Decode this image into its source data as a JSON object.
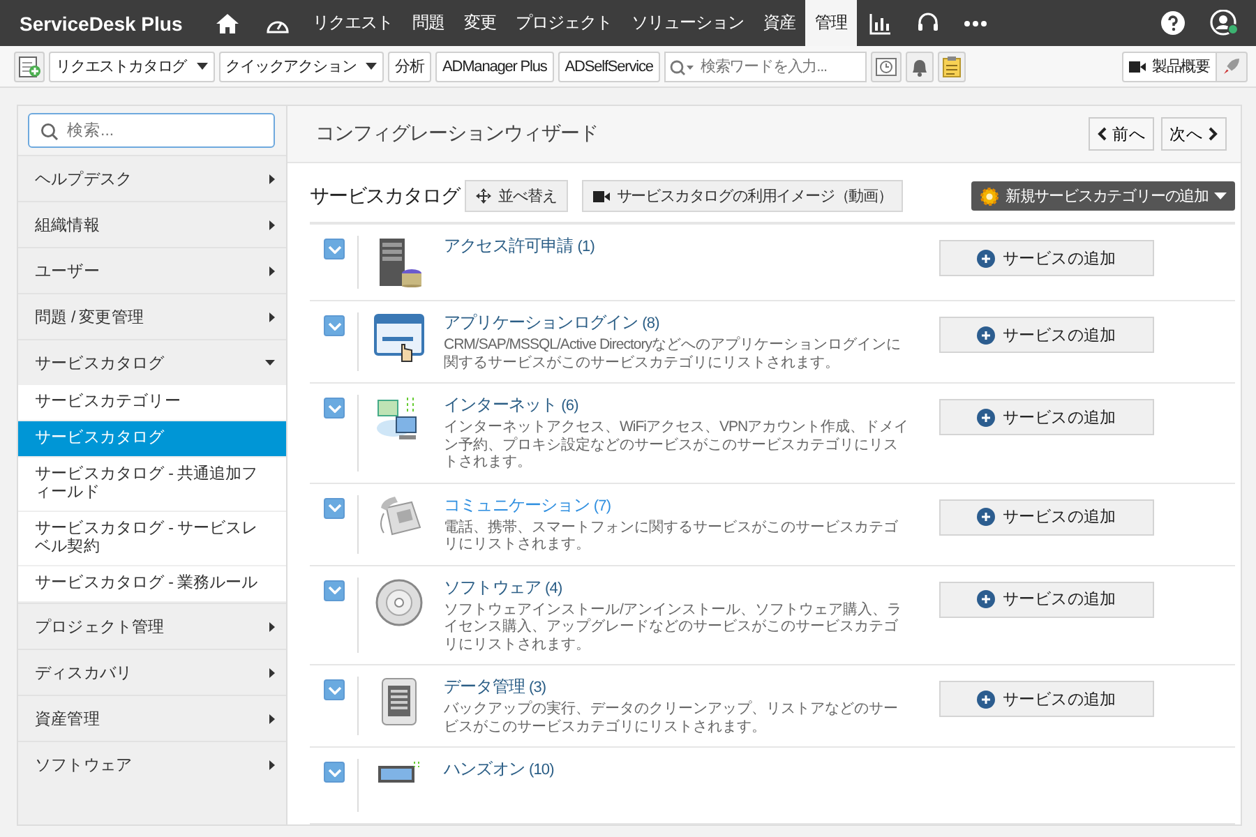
{
  "nav": {
    "logo": "ServiceDesk Plus",
    "tabs": [
      {
        "label": "リクエスト",
        "selected": false
      },
      {
        "label": "問題",
        "selected": false
      },
      {
        "label": "変更",
        "selected": false
      },
      {
        "label": "プロジェクト",
        "selected": false
      },
      {
        "label": "ソリューション",
        "selected": false
      },
      {
        "label": "資産",
        "selected": false
      },
      {
        "label": "管理",
        "selected": true
      }
    ]
  },
  "toolbar": {
    "dropdowns": [
      "リクエストカタログ",
      "クイックアクション"
    ],
    "buttons": [
      "分析",
      "ADManager Plus",
      "ADSelfService"
    ],
    "search": {
      "placeholder": "検索ワードを入力..."
    },
    "product_button": "製品概要"
  },
  "sidebar": {
    "search": {
      "placeholder": "検索..."
    },
    "items": [
      {
        "label": "ヘルプデスク",
        "expanded": false
      },
      {
        "label": "組織情報",
        "expanded": false
      },
      {
        "label": "ユーザー",
        "expanded": false
      },
      {
        "label": "問題 / 変更管理",
        "expanded": false
      },
      {
        "label": "サービスカタログ",
        "expanded": true,
        "children": [
          {
            "label": "サービスカテゴリー",
            "selected": false
          },
          {
            "label": "サービスカタログ",
            "selected": true
          },
          {
            "label": "サービスカタログ - 共通追加フィールド",
            "selected": false
          },
          {
            "label": "サービスカタログ - サービスレベル契約",
            "selected": false
          },
          {
            "label": "サービスカタログ - 業務ルール",
            "selected": false
          }
        ]
      },
      {
        "label": "プロジェクト管理",
        "expanded": false
      },
      {
        "label": "ディスカバリ",
        "expanded": false
      },
      {
        "label": "資産管理",
        "expanded": false
      },
      {
        "label": "ソフトウェア",
        "expanded": false
      }
    ]
  },
  "main": {
    "title": "コンフィグレーションウィザード",
    "prev": "前へ",
    "next": "次へ",
    "heading": "サービスカタログ",
    "sort_button": "並べ替え",
    "video_button": "サービスカタログの利用イメージ（動画）",
    "add_category_button": "新規サービスカテゴリーの追加",
    "categories": [
      {
        "title": "アクセス許可申請",
        "count": "(1)",
        "checked": true,
        "highlighted": false,
        "button": "サービスの追加"
      },
      {
        "title": "アプリケーションログイン",
        "count": "(8)",
        "description": "CRM/SAP/MSSQL/Active Directoryなどへのアプリケーションログインに関するサービスがこのサービスカテゴリにリストされます。",
        "checked": true,
        "highlighted": false,
        "button": "サービスの追加"
      },
      {
        "title": "インターネット",
        "count": "(6)",
        "description": "インターネットアクセス、WiFiアクセス、VPNアカウント作成、ドメイン予約、プロキシ設定などのサービスがこのサービスカテゴリにリストされます。",
        "checked": true,
        "highlighted": false,
        "button": "サービスの追加"
      },
      {
        "title": "コミュニケーション",
        "count": "(7)",
        "description": "電話、携帯、スマートフォンに関するサービスがこのサービスカテゴリにリストされます。",
        "checked": true,
        "highlighted": true,
        "button": "サービスの追加"
      },
      {
        "title": "ソフトウェア",
        "count": "(4)",
        "description": "ソフトウェアインストール/アンインストール、ソフトウェア購入、ライセンス購入、アップグレードなどのサービスがこのサービスカテゴリにリストされます。",
        "checked": true,
        "highlighted": false,
        "button": "サービスの追加"
      },
      {
        "title": "データ管理",
        "count": "(3)",
        "description": "バックアップの実行、データのクリーンアップ、リストアなどのサービスがこのサービスカテゴリにリストされます。",
        "checked": true,
        "highlighted": false,
        "button": "サービスの追加"
      },
      {
        "title": "ハンズオン",
        "count": "(10)",
        "checked": true,
        "highlighted": false
      }
    ]
  }
}
